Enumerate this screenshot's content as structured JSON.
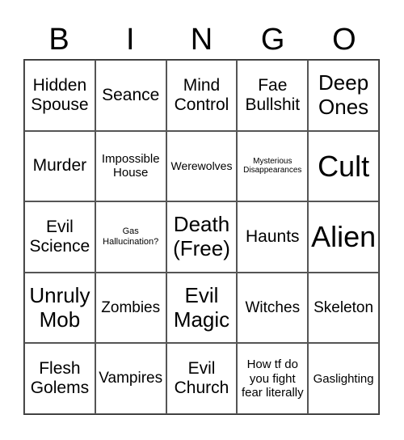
{
  "header": [
    "B",
    "I",
    "N",
    "G",
    "O"
  ],
  "cells": [
    {
      "text": "Hidden Spouse",
      "size": "m"
    },
    {
      "text": "Seance",
      "size": "m"
    },
    {
      "text": "Mind Control",
      "size": "m"
    },
    {
      "text": "Fae Bullshit",
      "size": "m"
    },
    {
      "text": "Deep Ones",
      "size": "l"
    },
    {
      "text": "Murder",
      "size": "m"
    },
    {
      "text": "Impossible House",
      "size": "s"
    },
    {
      "text": "Werewolves",
      "size": "xs"
    },
    {
      "text": "Mysterious Disappearances",
      "size": "tiny"
    },
    {
      "text": "Cult",
      "size": "xl"
    },
    {
      "text": "Evil Science",
      "size": "m"
    },
    {
      "text": "Gas Hallucination?",
      "size": "xxs"
    },
    {
      "text": "Death (Free)",
      "size": "l"
    },
    {
      "text": "Haunts",
      "size": "m"
    },
    {
      "text": "Alien",
      "size": "xl"
    },
    {
      "text": "Unruly Mob",
      "size": "l"
    },
    {
      "text": "Zombies",
      "size": "ms"
    },
    {
      "text": "Evil Magic",
      "size": "l"
    },
    {
      "text": "Witches",
      "size": "ms"
    },
    {
      "text": "Skeleton",
      "size": "ms"
    },
    {
      "text": "Flesh Golems",
      "size": "m"
    },
    {
      "text": "Vampires",
      "size": "ms"
    },
    {
      "text": "Evil Church",
      "size": "m"
    },
    {
      "text": "How tf do you fight fear literally",
      "size": "s"
    },
    {
      "text": "Gaslighting",
      "size": "s"
    }
  ]
}
